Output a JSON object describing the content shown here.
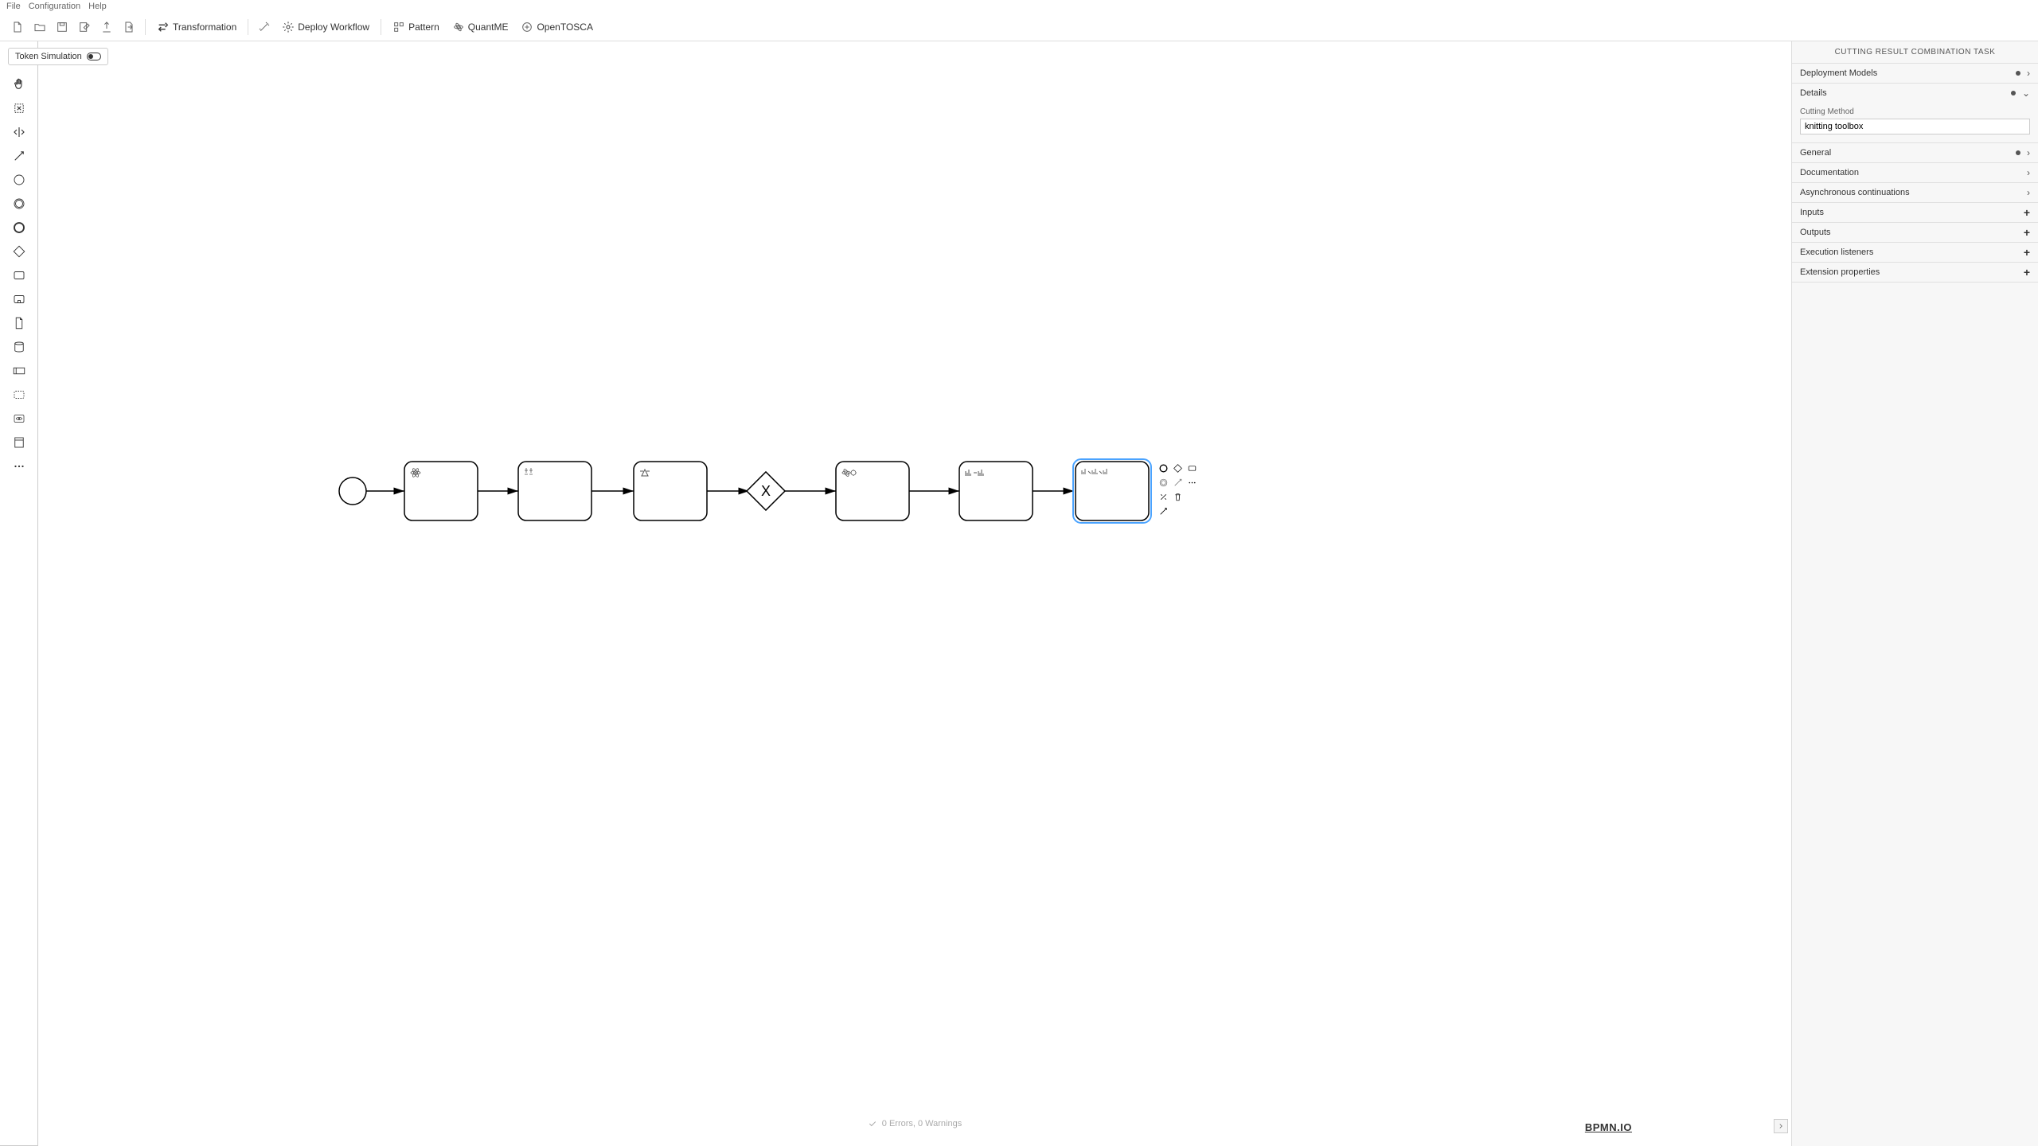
{
  "menu": {
    "file": "File",
    "configuration": "Configuration",
    "help": "Help"
  },
  "toolbar": {
    "transformation": "Transformation",
    "deploy": "Deploy Workflow",
    "pattern": "Pattern",
    "quantme": "QuantME",
    "opentosca": "OpenTOSCA"
  },
  "token_simulation": "Token Simulation",
  "status": "0 Errors, 0 Warnings",
  "logo": "BPMN.IO",
  "props": {
    "title": "CUTTING RESULT COMBINATION TASK",
    "sections": {
      "deployment": "Deployment Models",
      "details": "Details",
      "general": "General",
      "documentation": "Documentation",
      "async": "Asynchronous continuations",
      "inputs": "Inputs",
      "outputs": "Outputs",
      "execution": "Execution listeners",
      "extension": "Extension properties"
    },
    "cutting_method_label": "Cutting Method",
    "cutting_method_value": "knitting toolbox"
  }
}
